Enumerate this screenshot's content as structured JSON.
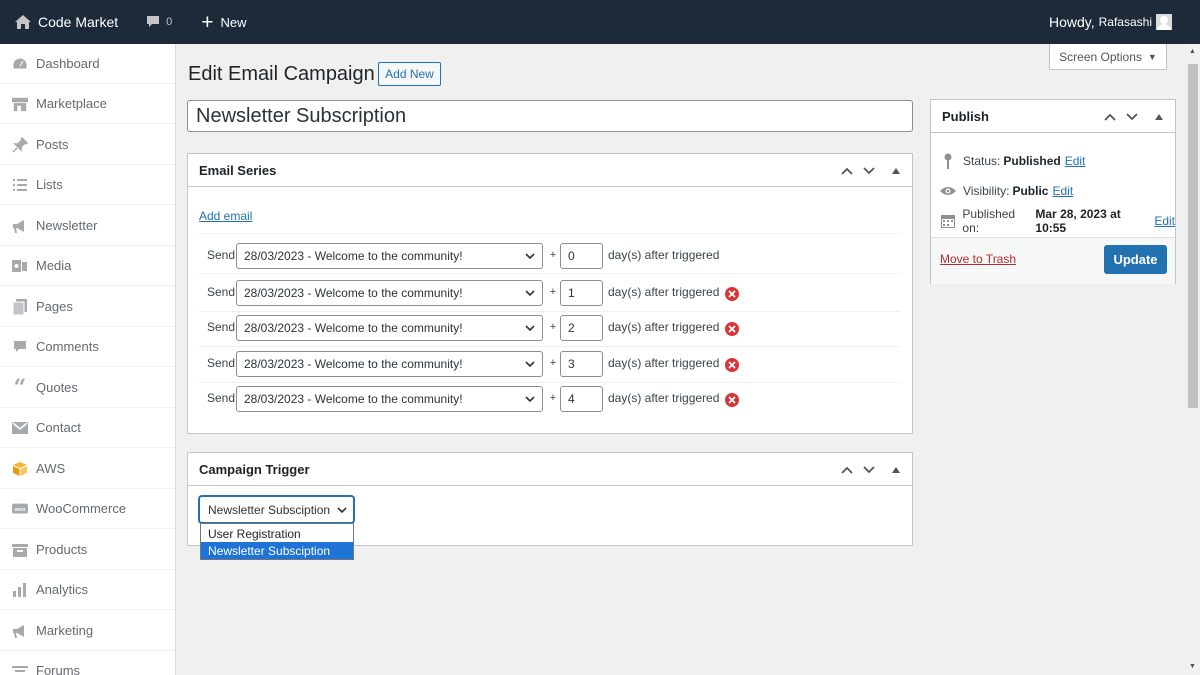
{
  "topbar": {
    "site_name": "Code Market",
    "comments_count": "0",
    "new_label": "New",
    "howdy": "Howdy,",
    "username": "Rafasashi"
  },
  "sidebar": {
    "items": [
      {
        "label": "Dashboard",
        "icon": "dashboard-icon"
      },
      {
        "label": "Marketplace",
        "icon": "store-icon"
      },
      {
        "label": "Posts",
        "icon": "pin-icon"
      },
      {
        "label": "Lists",
        "icon": "list-icon"
      },
      {
        "label": "Newsletter",
        "icon": "megaphone-icon"
      },
      {
        "label": "Media",
        "icon": "media-icon"
      },
      {
        "label": "Pages",
        "icon": "pages-icon"
      },
      {
        "label": "Comments",
        "icon": "comment-icon"
      },
      {
        "label": "Quotes",
        "icon": "quote-icon"
      },
      {
        "label": "Contact",
        "icon": "mail-icon"
      },
      {
        "label": "AWS",
        "icon": "aws-cube-icon"
      },
      {
        "label": "WooCommerce",
        "icon": "woo-icon"
      },
      {
        "label": "Products",
        "icon": "archive-icon"
      },
      {
        "label": "Analytics",
        "icon": "bar-chart-icon"
      },
      {
        "label": "Marketing",
        "icon": "megaphone-icon"
      },
      {
        "label": "Forums",
        "icon": "forum-icon"
      }
    ]
  },
  "screen_options": "Screen Options",
  "page": {
    "title": "Edit Email Campaign",
    "add_new": "Add New",
    "post_title": "Newsletter Subscription"
  },
  "email_series": {
    "title": "Email Series",
    "add_email": "Add email",
    "send_label": "Send",
    "plus": "+",
    "after_text": "day(s) after triggered",
    "rows": [
      {
        "email": "28/03/2023 - Welcome to the community!",
        "days": "0",
        "removable": false
      },
      {
        "email": "28/03/2023 - Welcome to the community!",
        "days": "1",
        "removable": true
      },
      {
        "email": "28/03/2023 - Welcome to the community!",
        "days": "2",
        "removable": true
      },
      {
        "email": "28/03/2023 - Welcome to the community!",
        "days": "3",
        "removable": true
      },
      {
        "email": "28/03/2023 - Welcome to the community!",
        "days": "4",
        "removable": true
      }
    ]
  },
  "campaign_trigger": {
    "title": "Campaign Trigger",
    "selected": "Newsletter Subsciption",
    "options": [
      "User Registration",
      "Newsletter Subsciption"
    ]
  },
  "publish": {
    "title": "Publish",
    "status_label": "Status:",
    "status_value": "Published",
    "visibility_label": "Visibility:",
    "visibility_value": "Public",
    "published_label": "Published on:",
    "published_value": "Mar 28, 2023 at 10:55",
    "edit": "Edit",
    "move_to_trash": "Move to Trash",
    "update": "Update"
  },
  "colors": {
    "admin_bar": "#1d2a3a",
    "accent": "#2271b1",
    "danger": "#d63638",
    "dropdown_highlight": "#1e74d6"
  }
}
